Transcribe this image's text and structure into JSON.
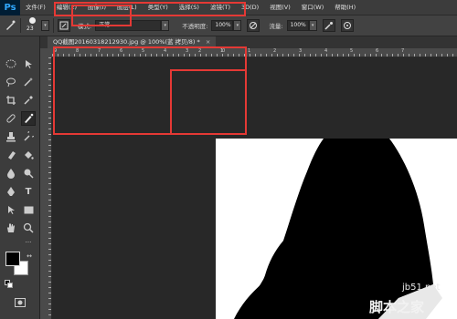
{
  "app": {
    "logo": "Ps"
  },
  "menu": [
    "文件(F)",
    "编辑(E)",
    "图像(I)",
    "图层(L)",
    "类型(Y)",
    "选择(S)",
    "滤镜(T)",
    "3D(D)",
    "视图(V)",
    "窗口(W)",
    "帮助(H)"
  ],
  "options": {
    "brush_size": "23",
    "mode_label": "模式:",
    "mode_value": "正常",
    "opacity_label": "不透明度:",
    "opacity_value": "100%",
    "flow_label": "流量:",
    "flow_value": "100%"
  },
  "document": {
    "tab_title": "QQ截图20160318212930.jpg @ 100%(蓝 拷贝/8) *",
    "close": "×"
  },
  "ruler": {
    "h_labels": [
      "9",
      "8",
      "7",
      "6",
      "5",
      "4",
      "3",
      "2",
      "1",
      "0",
      "1",
      "2",
      "3",
      "4",
      "5",
      "6",
      "7"
    ]
  },
  "watermark": {
    "line1": "jb51.net",
    "line2": "脚本之家"
  }
}
